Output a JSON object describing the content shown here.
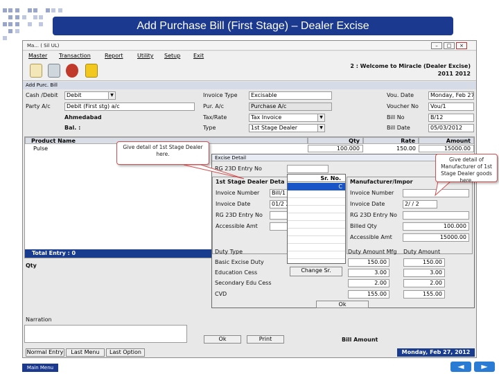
{
  "slide": {
    "title": "Add Purchase Bill (First Stage) – Dealer Excise",
    "main_menu": "Main Menu",
    "nav_prev": "◄",
    "nav_next": "►"
  },
  "window": {
    "title": "Ma... ( Sil UL)",
    "minimize": "–",
    "maximize": "□",
    "close": "×",
    "menu": [
      "Master",
      "Transaction",
      "Report",
      "Utility",
      "Setup",
      "Exit"
    ],
    "welcome_line1": "2 : Welcome to Miracle (Dealer Excise)",
    "welcome_line2": "2011  2012"
  },
  "form": {
    "subtitle": "Add Purc. Bill",
    "cash_debit_label": "Cash /Debit",
    "cash_debit_value": "Debit",
    "party_label": "Party A/c",
    "party_value": "Debit (First stg) a/c",
    "ahmedabad": "Ahmedabad",
    "bal_label": "Bal. :",
    "invoice_type_label": "Invoice Type",
    "invoice_type_value": "Excisable",
    "pur_ac_label": "Pur. A/c",
    "pur_ac_value": "Purchase A/c",
    "tax_rate_label": "Tax/Rate",
    "tax_rate_value": "Tax Invoice",
    "type_label": "Type",
    "type_value": "1st Stage Dealer",
    "vou_date_label": "Vou. Date",
    "vou_date_value": "Monday, Feb 27",
    "voucher_no_label": "Voucher No",
    "voucher_no_value": "Vou/1",
    "bill_no_label": "Bill No",
    "bill_no_value": "B/12",
    "bill_date_label": "Bill Date",
    "bill_date_value": "05/03/2012",
    "grid_headers": [
      "Product Name",
      "Qty",
      "Rate",
      "Amount"
    ],
    "grid_row": {
      "product": "Pulse",
      "qty": "100.000",
      "rate": "150.00",
      "amount": "15000.00"
    },
    "total_entry": "Total Entry : 0",
    "qty_label": "Qty",
    "narration_label": "Narration",
    "buttons": [
      "Normal Entry",
      "Last Menu",
      "Last Option"
    ],
    "bill_amount_label": "Bill Amount",
    "status_date": "Monday, Feb 27, 2012"
  },
  "excise": {
    "title": "Excise Detail",
    "pla_label": "RG 23D Entry No",
    "first_stage_head": "1st Stage Dealer Deta",
    "manufacturer_head": "Manufacturer/Impor",
    "left_labels": [
      "Invoice Number",
      "Invoice Date",
      "RG 23D Entry No",
      "Accessible Amt"
    ],
    "left_values": [
      "Bill/1",
      "01/2 2",
      "",
      ""
    ],
    "right_labels": [
      "Invoice Number",
      "Invoice Date",
      "RG 23D Entry No",
      "Billed Qty",
      "Accessible Amt"
    ],
    "right_values": [
      "",
      "2/ / 2",
      "",
      "100.000",
      "15000.00"
    ],
    "duty_type_label": "Duty Type",
    "duty_amount_label": "Duty Amount Mfg",
    "duty_amount2_label": "Duty Amount",
    "duty_rows": [
      {
        "name": "Basic Excise Duty",
        "v1": "150.00",
        "v2": "150.00"
      },
      {
        "name": "Education Cess",
        "v1": "3.00",
        "v2": "3.00"
      },
      {
        "name": "Secondary Edu Cess",
        "v1": "2.00",
        "v2": "2.00"
      },
      {
        "name": "CVD",
        "v1": "155.00",
        "v2": "155.00"
      }
    ],
    "change_sr": "Change Sr.",
    "ok_small": "Ok",
    "ok": "Ok",
    "print": "Print",
    "sr_no_header": "Sr. No.",
    "sr_first_row": "C"
  },
  "callouts": {
    "first_stage": "Give detail of 1st Stage Dealer here.",
    "manufacturer": "Give detail of Manufacturer of 1st Stage Dealer goods here."
  },
  "colors": {
    "title_bar": "#1b3a8f",
    "callout_border": "#d05050",
    "selected_row": "#1a55c8"
  }
}
